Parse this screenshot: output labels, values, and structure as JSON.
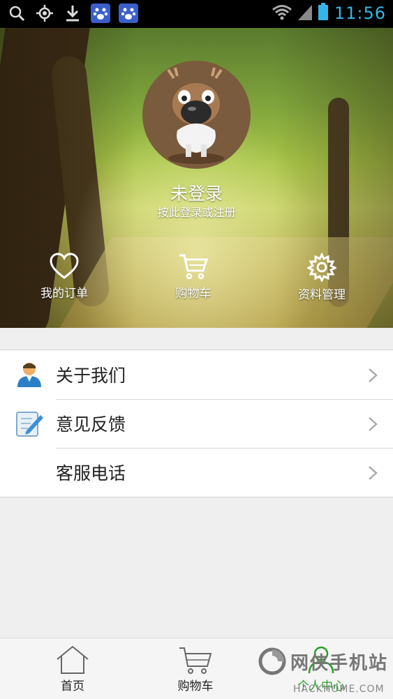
{
  "status_bar": {
    "time": "11:56",
    "left_icons": [
      "search-icon",
      "location-icon",
      "download-icon",
      "baidu-paw-icon",
      "baidu-paw-icon"
    ],
    "right_icons": [
      "wifi-icon",
      "signal-icon",
      "battery-icon"
    ],
    "clock_color": "#35b5e5"
  },
  "profile": {
    "title": "未登录",
    "subtitle": "按此登录或注册"
  },
  "quick_actions": [
    {
      "label": "我的订单",
      "icon": "heart-icon"
    },
    {
      "label": "购物车",
      "icon": "cart-icon"
    },
    {
      "label": "资料管理",
      "icon": "gear-icon"
    }
  ],
  "menu": [
    {
      "label": "关于我们",
      "icon": "person-icon"
    },
    {
      "label": "意见反馈",
      "icon": "edit-note-icon"
    },
    {
      "label": "客服电话",
      "icon": ""
    }
  ],
  "bottom_nav": [
    {
      "label": "首页",
      "icon": "home-icon"
    },
    {
      "label": "购物车",
      "icon": "cart-icon"
    },
    {
      "label": "个人中心",
      "icon": "person-icon",
      "active": true
    }
  ],
  "watermark": {
    "text": "网侠手机站",
    "sub": "HACKHOME.COM"
  },
  "colors": {
    "accent_active": "#2a9d2a",
    "list_text": "#222222",
    "background": "#efefef"
  }
}
